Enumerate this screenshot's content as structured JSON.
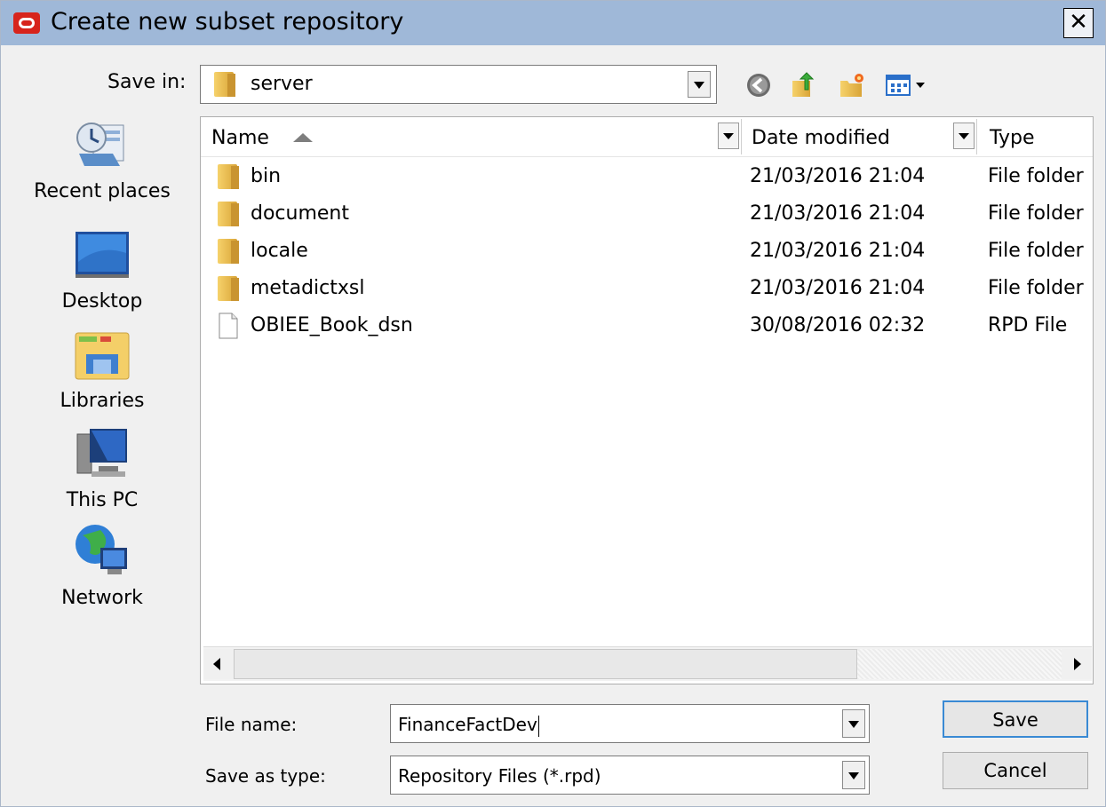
{
  "window": {
    "title": "Create new subset repository"
  },
  "toolbar": {
    "save_in_label": "Save in:",
    "save_in_value": "server"
  },
  "places": [
    {
      "label": "Recent places",
      "icon": "recent-places-icon"
    },
    {
      "label": "Desktop",
      "icon": "desktop-icon"
    },
    {
      "label": "Libraries",
      "icon": "libraries-icon"
    },
    {
      "label": "This PC",
      "icon": "this-pc-icon"
    },
    {
      "label": "Network",
      "icon": "network-icon"
    }
  ],
  "file_list": {
    "columns": {
      "name": "Name",
      "date": "Date modified",
      "type": "Type"
    },
    "rows": [
      {
        "name": "bin",
        "date": "21/03/2016 21:04",
        "type": "File folder",
        "icon": "folder-icon"
      },
      {
        "name": "document",
        "date": "21/03/2016 21:04",
        "type": "File folder",
        "icon": "folder-icon"
      },
      {
        "name": "locale",
        "date": "21/03/2016 21:04",
        "type": "File folder",
        "icon": "folder-icon"
      },
      {
        "name": "metadictxsl",
        "date": "21/03/2016 21:04",
        "type": "File folder",
        "icon": "folder-icon"
      },
      {
        "name": "OBIEE_Book_dsn",
        "date": "30/08/2016 02:32",
        "type": "RPD File",
        "icon": "file-icon"
      }
    ]
  },
  "form": {
    "file_name_label": "File name:",
    "file_name_value": "FinanceFactDev",
    "save_as_type_label": "Save as type:",
    "save_as_type_value": "Repository Files (*.rpd)",
    "save_button": "Save",
    "cancel_button": "Cancel"
  },
  "colors": {
    "titlebar": "#9fb8d8",
    "accent": "#3a8ad4",
    "folder": "#e8b84a"
  }
}
